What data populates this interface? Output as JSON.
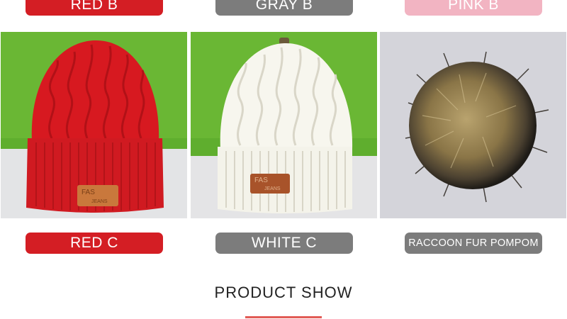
{
  "colors": {
    "red": "#d41e24",
    "gray": "#7c7c7c",
    "pink": "#f2b4c2",
    "underline": "#e15b55"
  },
  "top_labels": [
    "RED B",
    "GRAY B",
    "PINK B"
  ],
  "products": [
    {
      "label": "RED C",
      "image": "red-knit-beanie-image",
      "patch_text": [
        "FAS",
        "JEANS"
      ]
    },
    {
      "label": "WHITE C",
      "image": "white-knit-beanie-image",
      "patch_text": [
        "FAS",
        "JEANS"
      ]
    },
    {
      "label": "RACCOON FUR POMPOM",
      "image": "raccoon-fur-pompom-image"
    }
  ],
  "section": {
    "title": "PRODUCT SHOW"
  }
}
